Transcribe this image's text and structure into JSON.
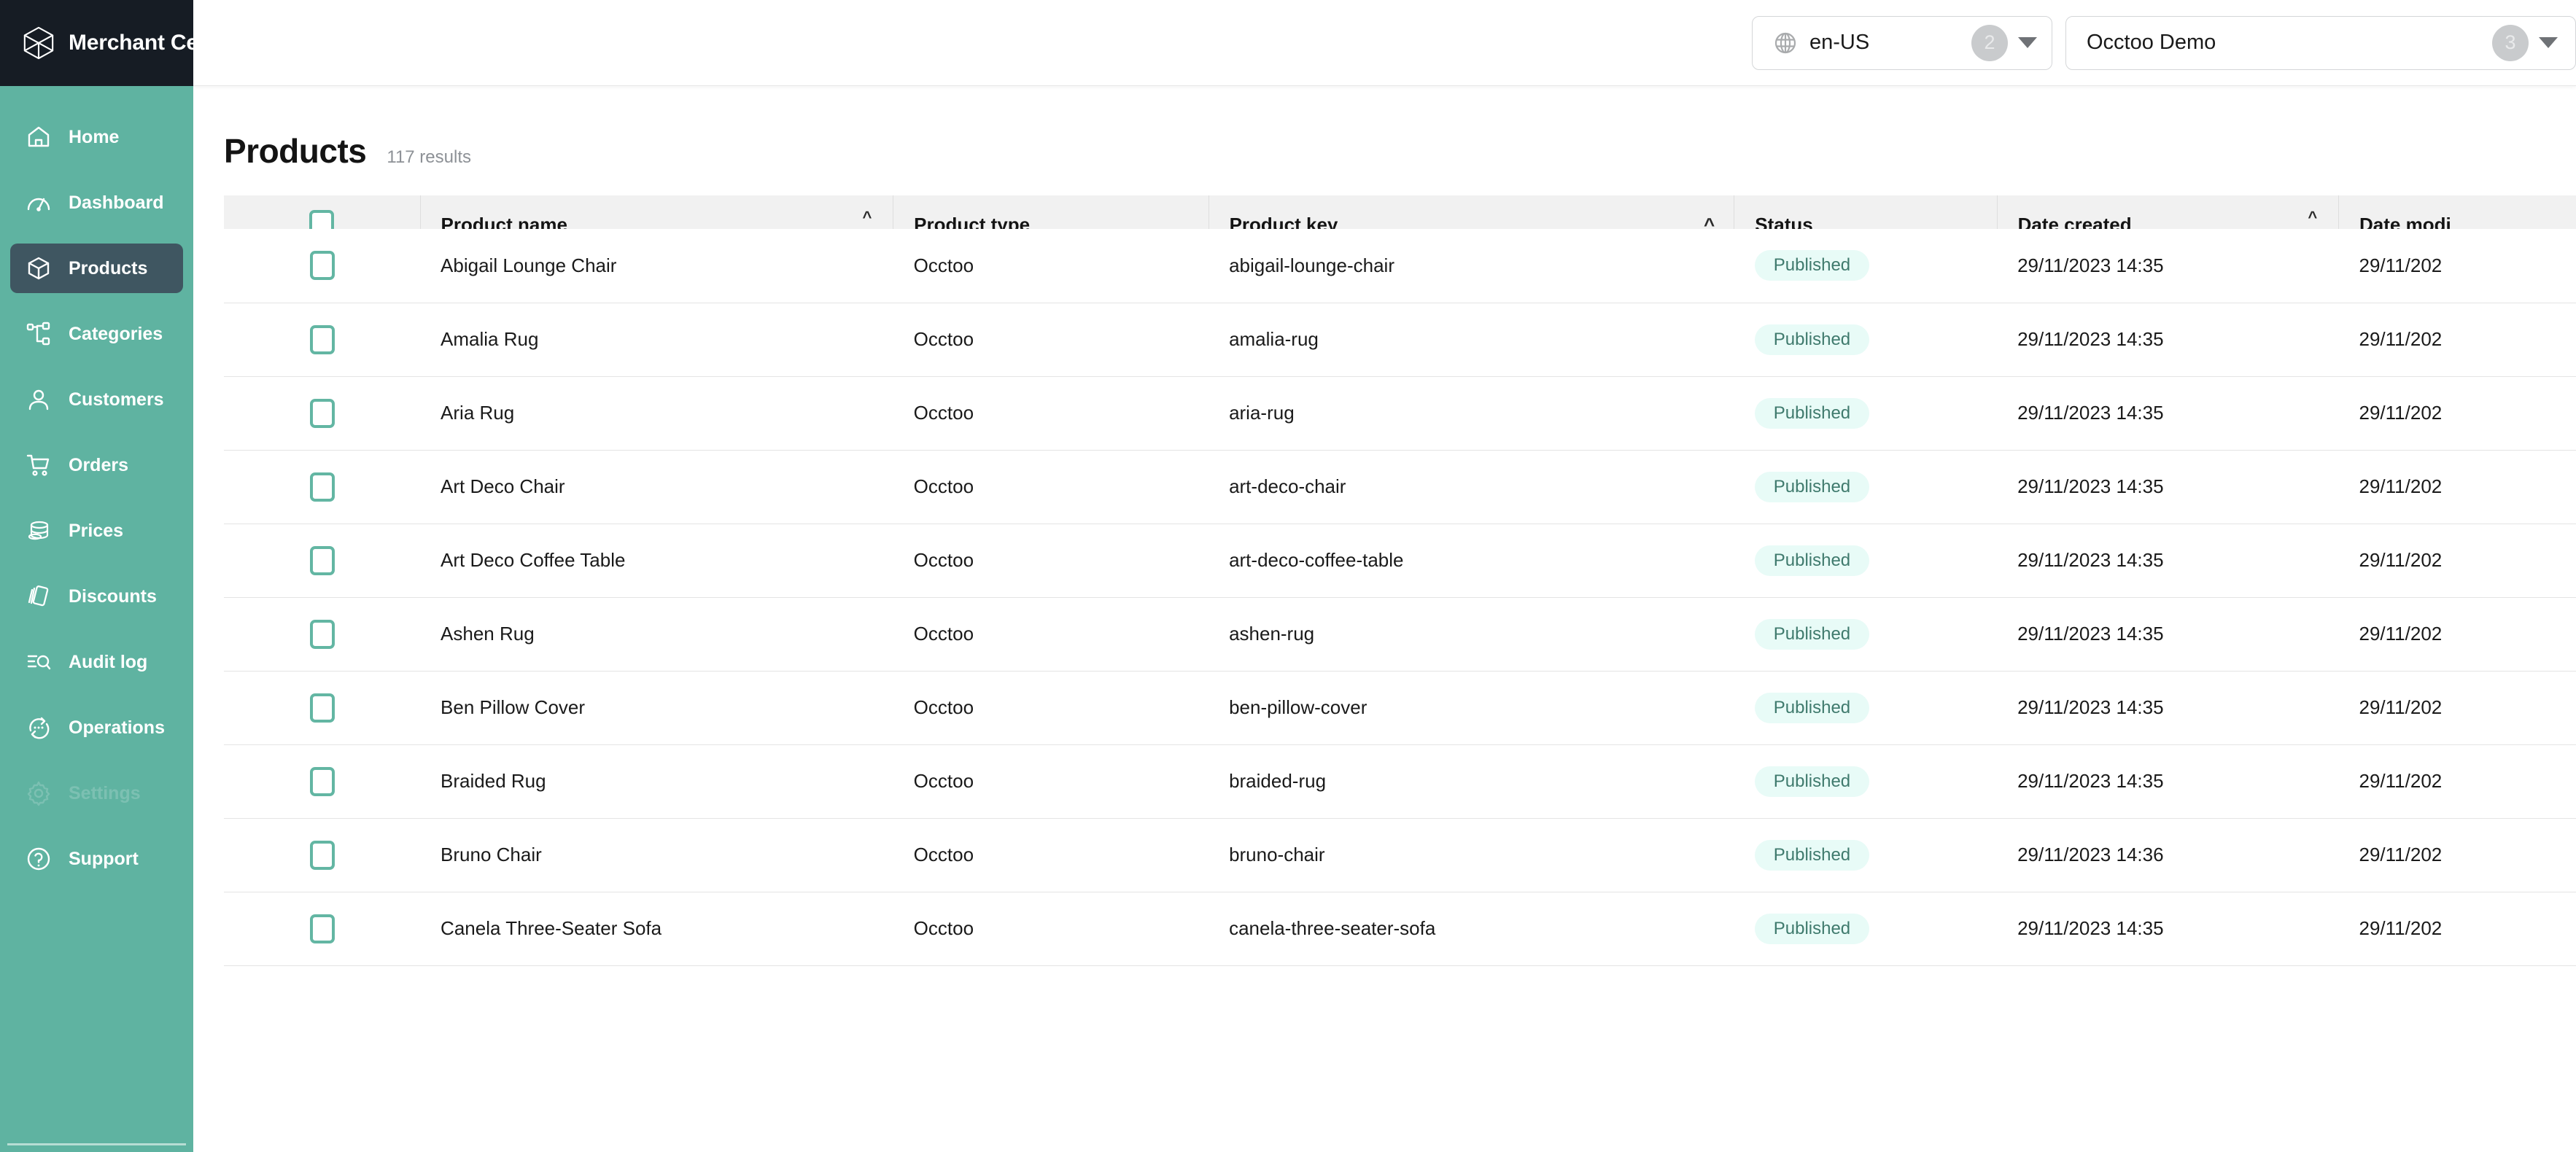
{
  "brand": {
    "title": "Merchant Center",
    "logo_icon": "cube-logo-icon"
  },
  "sidebar": {
    "items": [
      {
        "label": "Home",
        "icon": "home-icon",
        "active": false,
        "faded": false
      },
      {
        "label": "Dashboard",
        "icon": "gauge-icon",
        "active": false,
        "faded": false
      },
      {
        "label": "Products",
        "icon": "cube-icon",
        "active": true,
        "faded": false
      },
      {
        "label": "Categories",
        "icon": "sitemap-icon",
        "active": false,
        "faded": false
      },
      {
        "label": "Customers",
        "icon": "user-icon",
        "active": false,
        "faded": false
      },
      {
        "label": "Orders",
        "icon": "cart-icon",
        "active": false,
        "faded": false
      },
      {
        "label": "Prices",
        "icon": "coins-icon",
        "active": false,
        "faded": false
      },
      {
        "label": "Discounts",
        "icon": "tags-icon",
        "active": false,
        "faded": false
      },
      {
        "label": "Audit log",
        "icon": "list-search-icon",
        "active": false,
        "faded": false
      },
      {
        "label": "Operations",
        "icon": "refresh-dots-icon",
        "active": false,
        "faded": false
      },
      {
        "label": "Settings",
        "icon": "gear-icon",
        "active": false,
        "faded": true
      },
      {
        "label": "Support",
        "icon": "question-circle-icon",
        "active": false,
        "faded": false
      }
    ]
  },
  "topbar": {
    "locale_selector": {
      "icon": "globe-icon",
      "value": "en-US",
      "badge": "2",
      "caret": "chevron-down-icon"
    },
    "project_selector": {
      "value": "Occtoo Demo",
      "badge": "3",
      "caret": "chevron-down-icon"
    }
  },
  "page": {
    "title": "Products",
    "results": "117 results"
  },
  "table": {
    "columns": [
      {
        "key": "check",
        "label": "",
        "sort": "none"
      },
      {
        "key": "name",
        "label": "Product name",
        "sort": "both"
      },
      {
        "key": "type",
        "label": "Product type",
        "sort": "none"
      },
      {
        "key": "key",
        "label": "Product key",
        "sort": "asc"
      },
      {
        "key": "status",
        "label": "Status",
        "sort": "none"
      },
      {
        "key": "created",
        "label": "Date created",
        "sort": "both"
      },
      {
        "key": "modified",
        "label": "Date modi",
        "sort": "none"
      }
    ],
    "rows": [
      {
        "name": "Abigail Lounge Chair",
        "type": "Occtoo",
        "key": "abigail-lounge-chair",
        "status": "Published",
        "created": "29/11/2023 14:35",
        "modified": "29/11/202"
      },
      {
        "name": "Amalia Rug",
        "type": "Occtoo",
        "key": "amalia-rug",
        "status": "Published",
        "created": "29/11/2023 14:35",
        "modified": "29/11/202"
      },
      {
        "name": "Aria Rug",
        "type": "Occtoo",
        "key": "aria-rug",
        "status": "Published",
        "created": "29/11/2023 14:35",
        "modified": "29/11/202"
      },
      {
        "name": "Art Deco Chair",
        "type": "Occtoo",
        "key": "art-deco-chair",
        "status": "Published",
        "created": "29/11/2023 14:35",
        "modified": "29/11/202"
      },
      {
        "name": "Art Deco Coffee Table",
        "type": "Occtoo",
        "key": "art-deco-coffee-table",
        "status": "Published",
        "created": "29/11/2023 14:35",
        "modified": "29/11/202"
      },
      {
        "name": "Ashen Rug",
        "type": "Occtoo",
        "key": "ashen-rug",
        "status": "Published",
        "created": "29/11/2023 14:35",
        "modified": "29/11/202"
      },
      {
        "name": "Ben Pillow Cover",
        "type": "Occtoo",
        "key": "ben-pillow-cover",
        "status": "Published",
        "created": "29/11/2023 14:35",
        "modified": "29/11/202"
      },
      {
        "name": "Braided Rug",
        "type": "Occtoo",
        "key": "braided-rug",
        "status": "Published",
        "created": "29/11/2023 14:35",
        "modified": "29/11/202"
      },
      {
        "name": "Bruno Chair",
        "type": "Occtoo",
        "key": "bruno-chair",
        "status": "Published",
        "created": "29/11/2023 14:36",
        "modified": "29/11/202"
      },
      {
        "name": "Canela Three-Seater Sofa",
        "type": "Occtoo",
        "key": "canela-three-seater-sofa",
        "status": "Published",
        "created": "29/11/2023 14:35",
        "modified": "29/11/202"
      }
    ]
  },
  "colors": {
    "sidebar_green": "#5fb3a1",
    "sidebar_active": "#3f5661",
    "brand_dark": "#161c24",
    "checkbox_green": "#63b6a3",
    "pill_bg": "#e8fbf7",
    "pill_text": "#3f7a6d",
    "header_bg": "#f1f1f1"
  }
}
